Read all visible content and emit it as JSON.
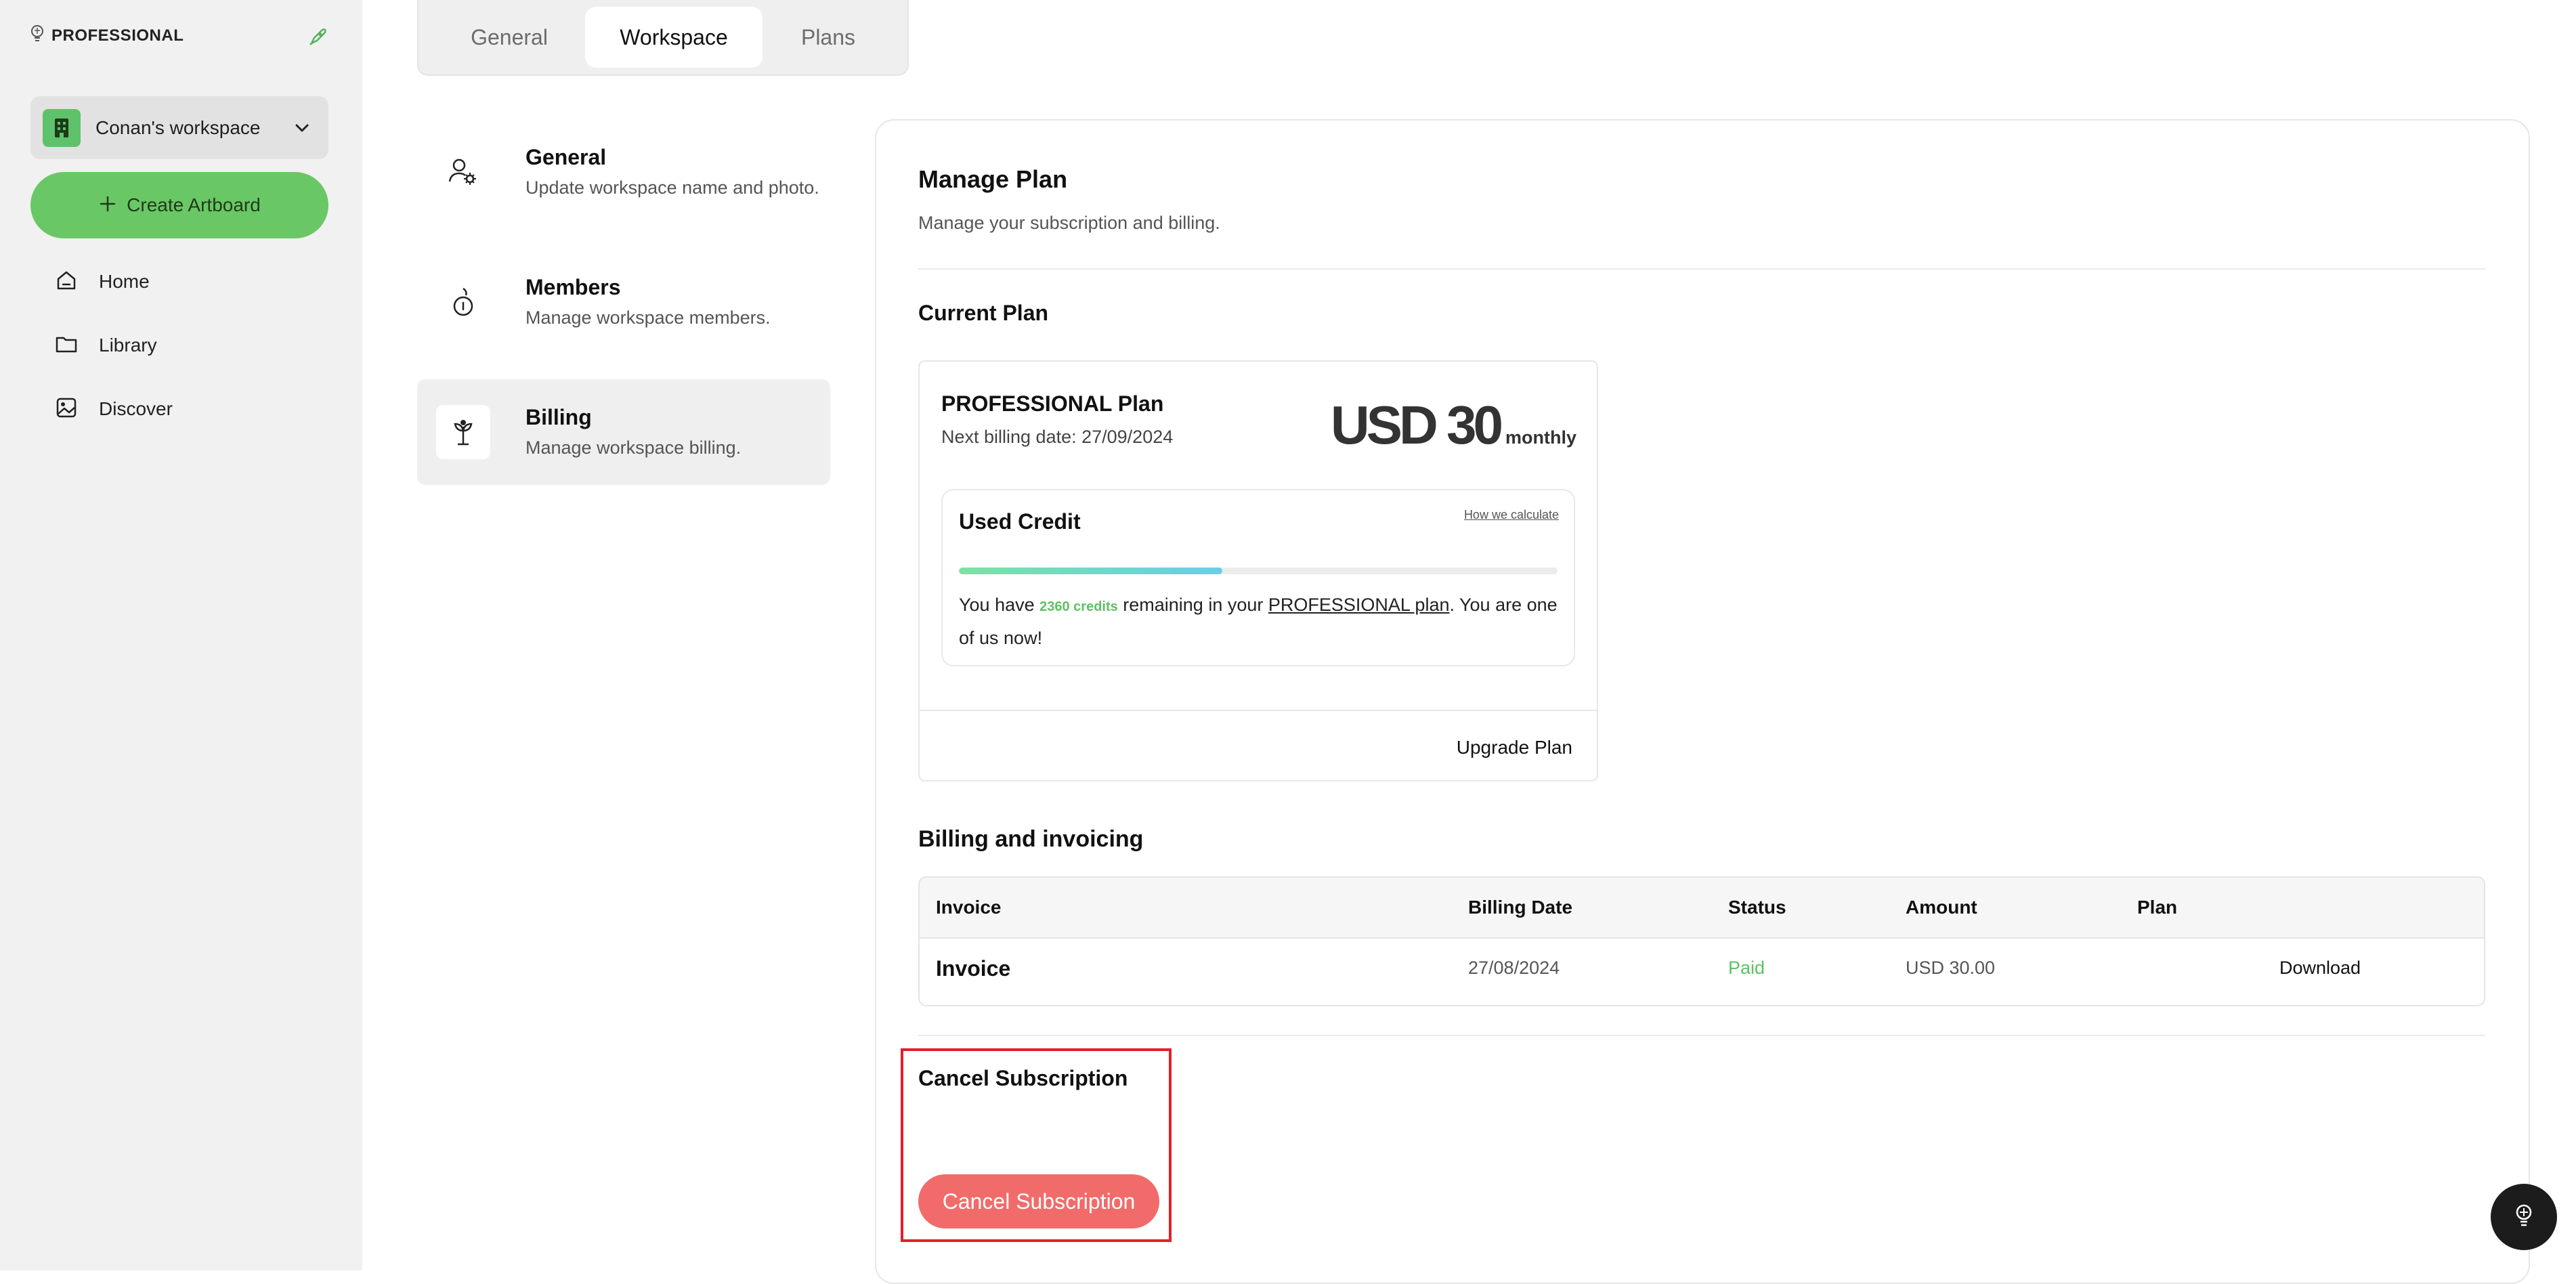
{
  "sidebar": {
    "brand": "PROFESSIONAL",
    "workspace_name": "Conan's workspace",
    "create_label": "Create Artboard",
    "nav": [
      {
        "label": "Home",
        "icon": "home-icon"
      },
      {
        "label": "Library",
        "icon": "folder-icon"
      },
      {
        "label": "Discover",
        "icon": "image-icon"
      }
    ]
  },
  "tabs": [
    "General",
    "Workspace",
    "Plans"
  ],
  "active_tab": "Workspace",
  "settings": [
    {
      "title": "General",
      "desc": "Update workspace name and photo.",
      "icon": "user-gear-icon"
    },
    {
      "title": "Members",
      "desc": "Manage workspace members.",
      "icon": "members-icon"
    },
    {
      "title": "Billing",
      "desc": "Manage workspace billing.",
      "icon": "sprout-icon"
    }
  ],
  "main": {
    "title": "Manage Plan",
    "subtitle": "Manage your subscription and billing.",
    "current_plan_heading": "Current Plan",
    "plan": {
      "name": "PROFESSIONAL Plan",
      "next_billing": "Next billing date: 27/09/2024",
      "price": "USD 30",
      "period": "monthly",
      "used_credit_title": "Used Credit",
      "how_link": "How we calculate",
      "used_fraction": 0.44,
      "credit_prefix": "You have ",
      "credits": "2360 credits",
      "credit_mid": " remaining in your ",
      "plan_link": "PROFESSIONAL plan",
      "credit_suffix": ". You are one of us now!",
      "upgrade_label": "Upgrade Plan"
    },
    "billing_heading": "Billing and invoicing",
    "table": {
      "headers": [
        "Invoice",
        "Billing Date",
        "Status",
        "Amount",
        "Plan"
      ],
      "rows": [
        {
          "invoice": "Invoice",
          "date": "27/08/2024",
          "status": "Paid",
          "amount": "USD 30.00",
          "action": "Download"
        }
      ]
    },
    "cancel_heading": "Cancel Subscription",
    "cancel_button": "Cancel Subscription"
  },
  "colors": {
    "accent_green": "#6ac765",
    "paid_green": "#5cc264",
    "danger": "#f26b6b",
    "highlight_border": "#e0202a"
  }
}
